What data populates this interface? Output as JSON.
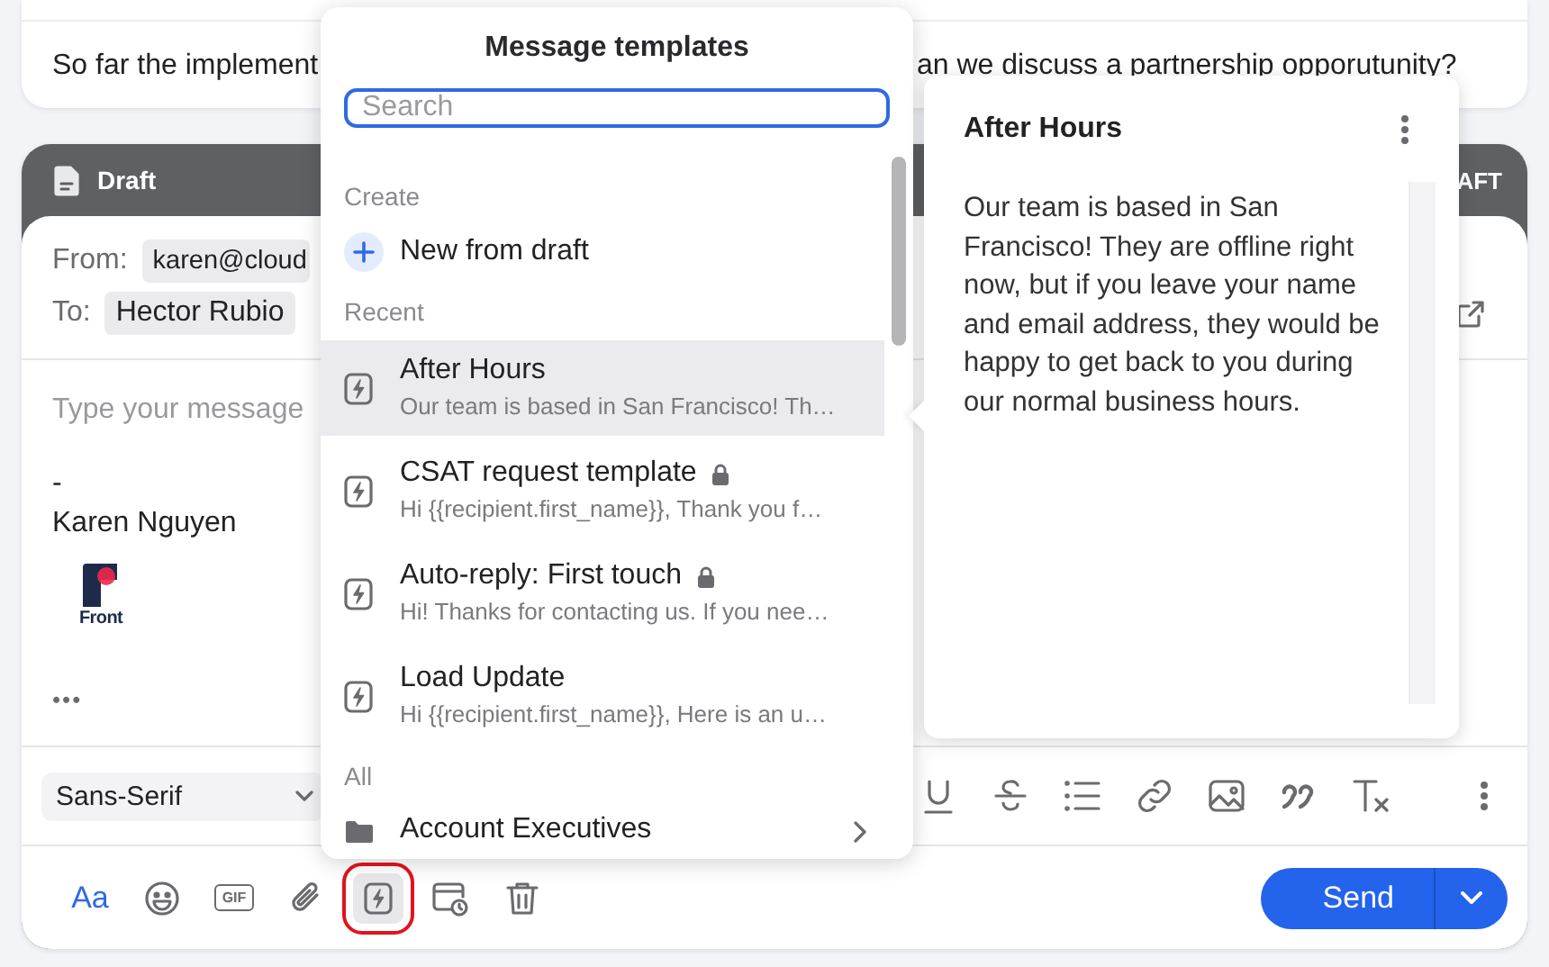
{
  "conversation": {
    "message_start": "So far the implement",
    "message_end": "an we discuss a partnership opporutunity?"
  },
  "draft": {
    "title": "Draft",
    "status": "AFT",
    "from_label": "From:",
    "from_value": "karen@cloud",
    "to_label": "To:",
    "to_value": "Hector Rubio",
    "placeholder": "Type your message",
    "signature_dash": "-",
    "signature_name": "Karen Nguyen",
    "logo_text": "Front",
    "more": "•••"
  },
  "format_bar": {
    "font": "Sans-Serif",
    "tools": [
      {
        "kind": "underline"
      },
      {
        "kind": "strikethrough"
      },
      {
        "kind": "list"
      },
      {
        "kind": "link"
      },
      {
        "kind": "image"
      },
      {
        "kind": "quote"
      },
      {
        "kind": "clear"
      },
      {
        "kind": "more"
      }
    ]
  },
  "compose_bar": {
    "tools": [
      {
        "kind": "text",
        "label": "Aa",
        "selected": false
      },
      {
        "kind": "emoji",
        "selected": false
      },
      {
        "kind": "gif",
        "label": "GIF",
        "selected": false
      },
      {
        "kind": "attach",
        "selected": false
      },
      {
        "kind": "template",
        "selected": true
      },
      {
        "kind": "schedule",
        "selected": false
      },
      {
        "kind": "delete",
        "selected": false
      }
    ],
    "send": "Send"
  },
  "templates": {
    "title": "Message templates",
    "search": {
      "placeholder": "Search",
      "focused": true
    },
    "sections": [
      {
        "label": "Create",
        "items": [
          {
            "kind": "action",
            "title": "New from draft",
            "selected": false
          }
        ]
      },
      {
        "label": "Recent",
        "items": [
          {
            "kind": "template",
            "title": "After Hours",
            "preview": "Our team is based in San Francisco! Th…",
            "locked": false,
            "selected": true
          },
          {
            "kind": "template",
            "title": "CSAT request template",
            "preview": "Hi {{recipient.first_name}}, Thank you f…",
            "locked": true,
            "selected": false
          },
          {
            "kind": "template",
            "title": "Auto-reply: First touch",
            "preview": "Hi! Thanks for contacting us. If you nee…",
            "locked": true,
            "selected": false
          },
          {
            "kind": "template",
            "title": "Load Update",
            "preview": "Hi {{recipient.first_name}}, Here is an u…",
            "locked": false,
            "selected": false
          }
        ]
      },
      {
        "label": "All",
        "items": [
          {
            "kind": "folder",
            "title": "Account Executives",
            "selected": false
          }
        ]
      }
    ]
  },
  "preview": {
    "title": "After Hours",
    "body": "Our team is based in San Francisco! They are offline right now, but if you leave your name and email address, they would be happy to get back to you during our normal business hours."
  }
}
